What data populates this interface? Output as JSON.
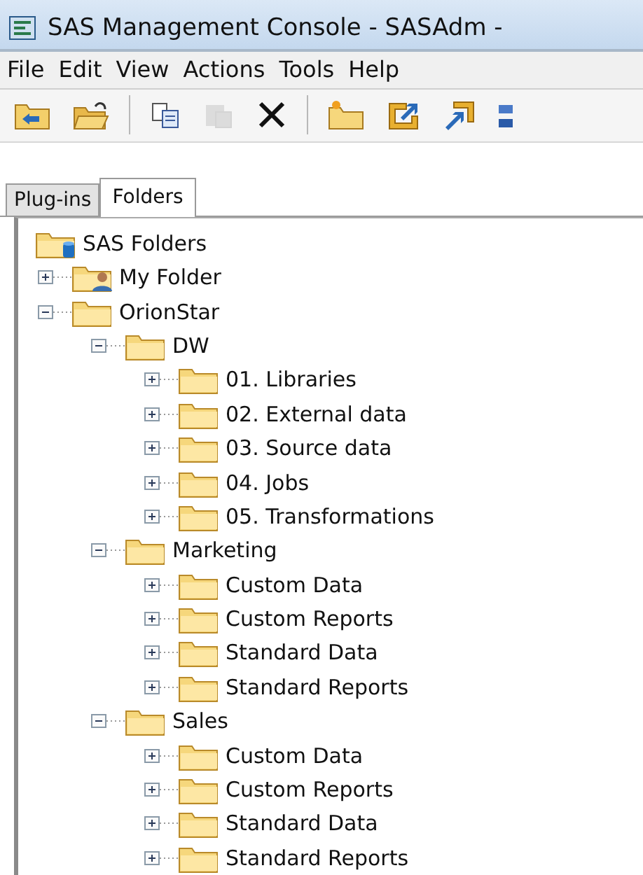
{
  "window": {
    "title": "SAS Management Console - SASAdm -"
  },
  "menu": [
    "File",
    "Edit",
    "View",
    "Actions",
    "Tools",
    "Help"
  ],
  "toolbar": [
    {
      "kind": "up-folder",
      "disabled": false
    },
    {
      "kind": "open-folder",
      "disabled": false
    },
    {
      "kind": "separator"
    },
    {
      "kind": "copy",
      "disabled": false
    },
    {
      "kind": "paste",
      "disabled": true
    },
    {
      "kind": "delete",
      "disabled": false
    },
    {
      "kind": "separator"
    },
    {
      "kind": "new-folder",
      "disabled": false
    },
    {
      "kind": "export",
      "disabled": false
    },
    {
      "kind": "import",
      "disabled": false
    },
    {
      "kind": "partial",
      "disabled": false
    }
  ],
  "tabs": [
    {
      "label": "Plug-ins",
      "selected": false
    },
    {
      "label": "Folders",
      "selected": true
    }
  ],
  "tree": {
    "label": "SAS Folders",
    "kind": "root",
    "children": [
      {
        "label": "My Folder",
        "kind": "user",
        "expanded": false
      },
      {
        "label": "OrionStar",
        "kind": "folder",
        "expanded": true,
        "children": [
          {
            "label": "DW",
            "kind": "folder",
            "expanded": true,
            "children": [
              {
                "label": "01. Libraries",
                "kind": "folder",
                "expanded": false
              },
              {
                "label": "02. External data",
                "kind": "folder",
                "expanded": false
              },
              {
                "label": "03. Source data",
                "kind": "folder",
                "expanded": false
              },
              {
                "label": "04. Jobs",
                "kind": "folder",
                "expanded": false
              },
              {
                "label": "05. Transformations",
                "kind": "folder",
                "expanded": false
              }
            ]
          },
          {
            "label": "Marketing",
            "kind": "folder",
            "expanded": true,
            "children": [
              {
                "label": "Custom Data",
                "kind": "folder",
                "expanded": false
              },
              {
                "label": "Custom Reports",
                "kind": "folder",
                "expanded": false
              },
              {
                "label": "Standard Data",
                "kind": "folder",
                "expanded": false
              },
              {
                "label": "Standard Reports",
                "kind": "folder",
                "expanded": false
              }
            ]
          },
          {
            "label": "Sales",
            "kind": "folder",
            "expanded": true,
            "children": [
              {
                "label": "Custom Data",
                "kind": "folder",
                "expanded": false
              },
              {
                "label": "Custom Reports",
                "kind": "folder",
                "expanded": false
              },
              {
                "label": "Standard Data",
                "kind": "folder",
                "expanded": false
              },
              {
                "label": "Standard Reports",
                "kind": "folder",
                "expanded": false
              }
            ]
          }
        ]
      }
    ]
  }
}
